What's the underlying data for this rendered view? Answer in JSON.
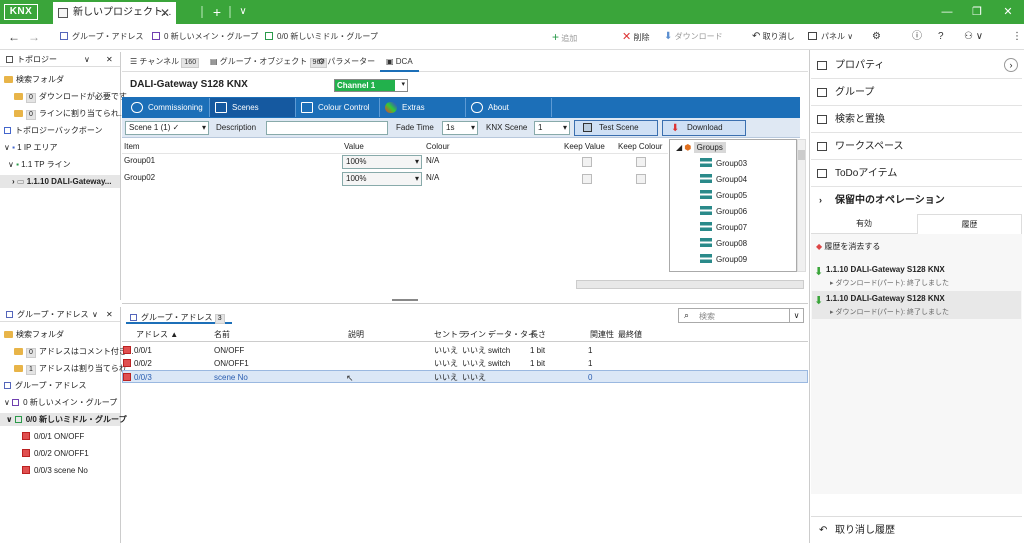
{
  "titlebar": {
    "logo": "KNX",
    "tab_title": "新しいプロジェクト...",
    "close": "✕",
    "add": "+",
    "dropdown": "∨",
    "minimize": "—",
    "restore": "❐",
    "close_window": "✕"
  },
  "toolbar": {
    "back": "←",
    "forward": "→",
    "crumb1": "グループ・アドレス",
    "crumb2": "0 新しいメイン・グループ",
    "crumb3": "0/0 新しいミドル・グループ",
    "add": "追加",
    "delete": "削除",
    "download": "ダウンロード",
    "undo": "取り消し",
    "panel": "パネル"
  },
  "topology": {
    "header": "トポロジー",
    "search_folder": "検索フォルダ",
    "item1_badge": "0",
    "item1": "ダウンロードが必要です",
    "item2_badge": "0",
    "item2": "ラインに割り当てられ...",
    "backbone": "トポロジーバックボーン",
    "area": "1 IP エリア",
    "line": "1.1 TP ライン",
    "device": "1.1.10 DALI-Gateway..."
  },
  "groupaddr_panel": {
    "header": "グループ・アドレス",
    "search_folder": "検索フォルダ",
    "item1_badge": "0",
    "item1": "アドレスはコメント付き...",
    "item2_badge": "1",
    "item2": "アドレスは割り当てられ...",
    "root": "グループ・アドレス",
    "main": "0 新しいメイン・グループ",
    "middle": "0/0 新しいミドル・グループ",
    "ga1": "0/0/1 ON/OFF",
    "ga2": "0/0/2 ON/OFF1",
    "ga3": "0/0/3 scene No"
  },
  "dca": {
    "tab_channel": "チャンネル",
    "tab_channel_count": "160",
    "tab_go": "グループ・オブジェクト",
    "tab_go_count": "967",
    "tab_param": "パラメーター",
    "tab_dca": "DCA",
    "device_title": "DALI-Gateway S128 KNX",
    "channel": "Channel 1",
    "tabs": [
      "Commissioning",
      "Scenes",
      "Colour Control",
      "Extras",
      "About"
    ],
    "scene_select": "Scene 1 (1)",
    "description_label": "Description",
    "fade_label": "Fade Time",
    "fade_value": "1s",
    "knx_scene_label": "KNX Scene",
    "knx_scene_value": "1",
    "test_scene": "Test Scene",
    "download": "Download",
    "cols": {
      "item": "Item",
      "value": "Value",
      "colour": "Colour",
      "keep_value": "Keep Value",
      "keep_colour": "Keep Colour"
    },
    "rows": [
      {
        "item": "Group01",
        "value": "100%",
        "colour": "N/A"
      },
      {
        "item": "Group02",
        "value": "100%",
        "colour": "N/A"
      }
    ],
    "groups_root": "Groups",
    "groups": [
      "Group03",
      "Group04",
      "Group05",
      "Group06",
      "Group07",
      "Group08",
      "Group09"
    ]
  },
  "ga_table": {
    "tab": "グループ・アドレス",
    "tab_count": "3",
    "search_placeholder": "検索",
    "cols": {
      "address": "アドレス ▲",
      "name": "名前",
      "desc": "説明",
      "central": "セントラ",
      "line": "ライン・",
      "dpt": "データ・タイ",
      "length": "長さ",
      "assoc": "関連性",
      "last": "最終値"
    },
    "rows": [
      {
        "address": "0/0/1",
        "name": "ON/OFF",
        "central": "いいえ",
        "line": "いいえ",
        "dpt": "switch",
        "length": "1 bit",
        "assoc": "1"
      },
      {
        "address": "0/0/2",
        "name": "ON/OFF1",
        "central": "いいえ",
        "line": "いいえ",
        "dpt": "switch",
        "length": "1 bit",
        "assoc": "1"
      },
      {
        "address": "0/0/3",
        "name": "scene No",
        "central": "いいえ",
        "line": "いいえ",
        "dpt": "",
        "length": "",
        "assoc": "0"
      }
    ]
  },
  "right": {
    "properties": "プロパティ",
    "groups": "グループ",
    "search_replace": "検索と置換",
    "workspace": "ワークスペース",
    "todo": "ToDoアイテム",
    "pending": "保留中のオペレーション",
    "tab_valid": "有効",
    "tab_history": "履歴",
    "clear_history": "履歴を消去する",
    "history": [
      {
        "title": "1.1.10 DALI-Gateway S128 KNX",
        "sub": "ダウンロード(パート): 終了しました"
      },
      {
        "title": "1.1.10 DALI-Gateway S128 KNX",
        "sub": "ダウンロード(パート): 終了しました"
      }
    ],
    "undo_history": "取り消し履歴"
  },
  "colors": {
    "green": "#3aa53a",
    "blue": "#1c6fb8",
    "selection": "#dbe7f6"
  }
}
